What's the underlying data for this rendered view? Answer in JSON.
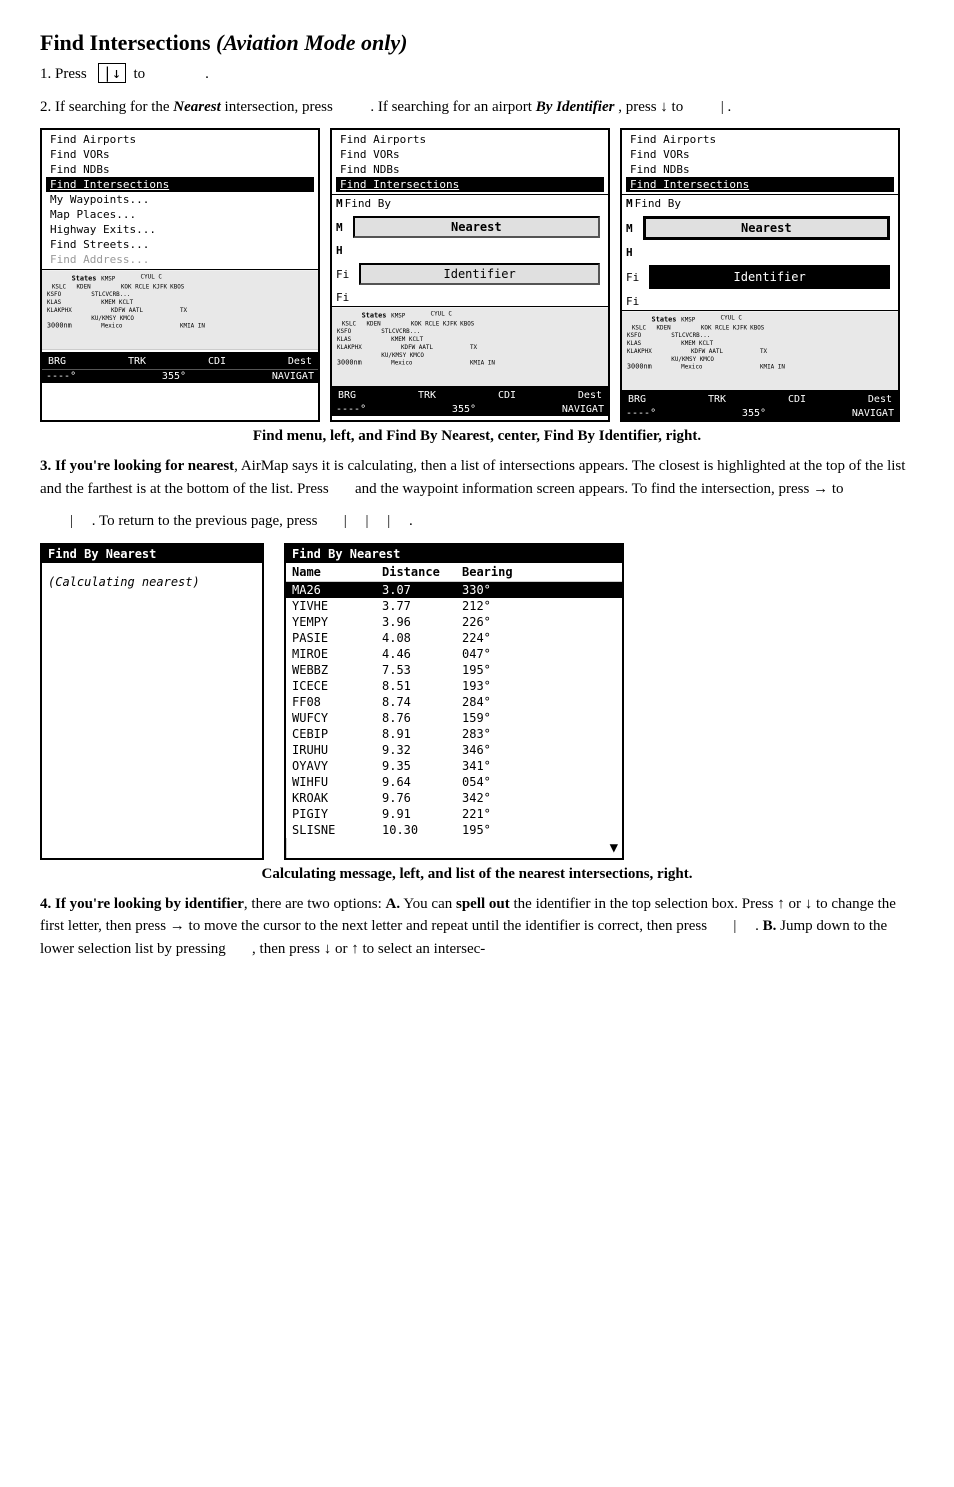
{
  "title": {
    "main": "Find Intersections",
    "italic": " (Aviation Mode only)"
  },
  "steps": {
    "step1": {
      "text_before": "1. Press",
      "symbol": "↓",
      "text_after": "to",
      "dot": "."
    },
    "step2": {
      "text": "2. If searching for the",
      "bold_italic": "Nearest",
      "text2": "intersection, press",
      "text3": ". If searching for an airport",
      "bold_italic2": "By Identifier",
      "text4": ", press ↓ to",
      "pipe": "|",
      "dot": "."
    }
  },
  "panels": [
    {
      "id": "left",
      "menu_items": [
        {
          "label": "Find Airports",
          "selected": false
        },
        {
          "label": "Find VORs",
          "selected": false
        },
        {
          "label": "Find NDBs",
          "selected": false
        },
        {
          "label": "Find Intersections",
          "selected": true
        },
        {
          "label": "My Waypoints...",
          "selected": false
        },
        {
          "label": "Map Places...",
          "selected": false
        },
        {
          "label": "Highway Exits...",
          "selected": false
        },
        {
          "label": "Find Streets...",
          "selected": false
        },
        {
          "label": "Find Address...",
          "selected": false
        }
      ],
      "show_findby": false,
      "show_nearest": false,
      "show_identifier": false
    },
    {
      "id": "center",
      "menu_items": [
        {
          "label": "Find Airports",
          "selected": false
        },
        {
          "label": "Find VORs",
          "selected": false
        },
        {
          "label": "Find NDBs",
          "selected": false
        },
        {
          "label": "Find Intersections",
          "selected": true
        }
      ],
      "show_findby": true,
      "findby_letter": "M",
      "show_nearest": true,
      "nearest_label": "Nearest",
      "row_h": "H",
      "show_identifier": true,
      "identifier_label": "Identifier",
      "row_fi": "Fi",
      "row_fi2": "Fi"
    },
    {
      "id": "right",
      "menu_items": [
        {
          "label": "Find Airports",
          "selected": false
        },
        {
          "label": "Find VORs",
          "selected": false
        },
        {
          "label": "Find NDBs",
          "selected": false
        },
        {
          "label": "Find Intersections",
          "selected": true
        }
      ],
      "show_findby": true,
      "findby_letter": "M",
      "show_nearest": true,
      "nearest_label": "Nearest",
      "row_h": "H",
      "show_identifier": true,
      "identifier_label": "Identifier",
      "row_fi": "Fi",
      "row_fi2": "Fi"
    }
  ],
  "panel_caption": "Find menu, left, and Find By Nearest, center, Find By Identifier, right.",
  "step3": {
    "text1": "3.",
    "bold": "If you're looking for nearest",
    "text2": ", AirMap says it is calculating, then a list of intersections appears. The closest is highlighted at the top of the list and the farthest is at the bottom of the list. Press",
    "text3": "and the waypoint information screen appears. To find the intersection, press → to",
    "pipe1": "|",
    "text4": ". To return to the previous page, press",
    "pipe2": "|",
    "pipe3": "|",
    "pipe4": "|",
    "dot": "."
  },
  "nearest_panels": {
    "left": {
      "title": "Find By Nearest",
      "calculating": "(Calculating nearest)"
    },
    "right": {
      "title": "Find By Nearest",
      "col_name": "Name",
      "col_distance": "Distance",
      "col_bearing": "Bearing",
      "rows": [
        {
          "name": "MA26",
          "distance": "3.07",
          "bearing": "330°",
          "selected": true
        },
        {
          "name": "YIVHE",
          "distance": "3.77",
          "bearing": "212°",
          "selected": false
        },
        {
          "name": "YEMPY",
          "distance": "3.96",
          "bearing": "226°",
          "selected": false
        },
        {
          "name": "PASIE",
          "distance": "4.08",
          "bearing": "224°",
          "selected": false
        },
        {
          "name": "MIROE",
          "distance": "4.46",
          "bearing": "047°",
          "selected": false
        },
        {
          "name": "WEBBZ",
          "distance": "7.53",
          "bearing": "195°",
          "selected": false
        },
        {
          "name": "ICECE",
          "distance": "8.51",
          "bearing": "193°",
          "selected": false
        },
        {
          "name": "FF08",
          "distance": "8.74",
          "bearing": "284°",
          "selected": false
        },
        {
          "name": "WUFCY",
          "distance": "8.76",
          "bearing": "159°",
          "selected": false
        },
        {
          "name": "CEBIP",
          "distance": "8.91",
          "bearing": "283°",
          "selected": false
        },
        {
          "name": "IRUHU",
          "distance": "9.32",
          "bearing": "346°",
          "selected": false
        },
        {
          "name": "OYAVY",
          "distance": "9.35",
          "bearing": "341°",
          "selected": false
        },
        {
          "name": "WIHFU",
          "distance": "9.64",
          "bearing": "054°",
          "selected": false
        },
        {
          "name": "KROAK",
          "distance": "9.76",
          "bearing": "342°",
          "selected": false
        },
        {
          "name": "PIGIY",
          "distance": "9.91",
          "bearing": "221°",
          "selected": false
        },
        {
          "name": "SLISNE",
          "distance": "10.30",
          "bearing": "195°",
          "selected": false
        }
      ]
    }
  },
  "nearest_caption": "Calculating message, left, and list of the nearest intersections, right.",
  "step4": {
    "number": "4.",
    "bold": "If you're looking by identifier",
    "text1": ", there are two options:",
    "bold_a": "A.",
    "text2": "You can",
    "bold2": "spell out",
    "text3": "the identifier in the top selection box. Press ↑ or ↓ to change the first letter, then press → to move the cursor to the next letter and repeat until the identifier is correct, then press",
    "pipe": "|",
    "dot": ".",
    "bold_b": "B.",
    "text4": "Jump down to the lower selection list by pressing",
    "text5": ", then press ↓ or ↑ to select an intersec-"
  },
  "map_labels": {
    "states_kmsp": "StatesKMSP",
    "cyul": "CYUL",
    "kslc": "KSLC",
    "kden": "KDEN",
    "kok": "KOK",
    "rcle": "RCLE",
    "kjfk": "KJFK",
    "kbos": "KBOS",
    "ksfo": "KSFO",
    "stlcvcrb": "STLCVCRB",
    "klas": "KLAS",
    "kmem": "KMEM",
    "kclt": "KCLT",
    "klakphx": "KLAKPHX",
    "kdfw": "KDFW",
    "aatl": "AATL",
    "tx": "TX",
    "kukmsy": "KU/KMSY",
    "kmco": "KMCO",
    "nm3000": "3000nm",
    "mexico": "Mexico",
    "kmia": "KMIA",
    "bottom_brg": "BRG",
    "bottom_trk": "TRK",
    "bottom_cdi": "CDI",
    "bottom_dest": "Dest",
    "bottom_dash": "----°",
    "bottom_355": "355°",
    "bottom_nav": "NAVIGAT"
  }
}
